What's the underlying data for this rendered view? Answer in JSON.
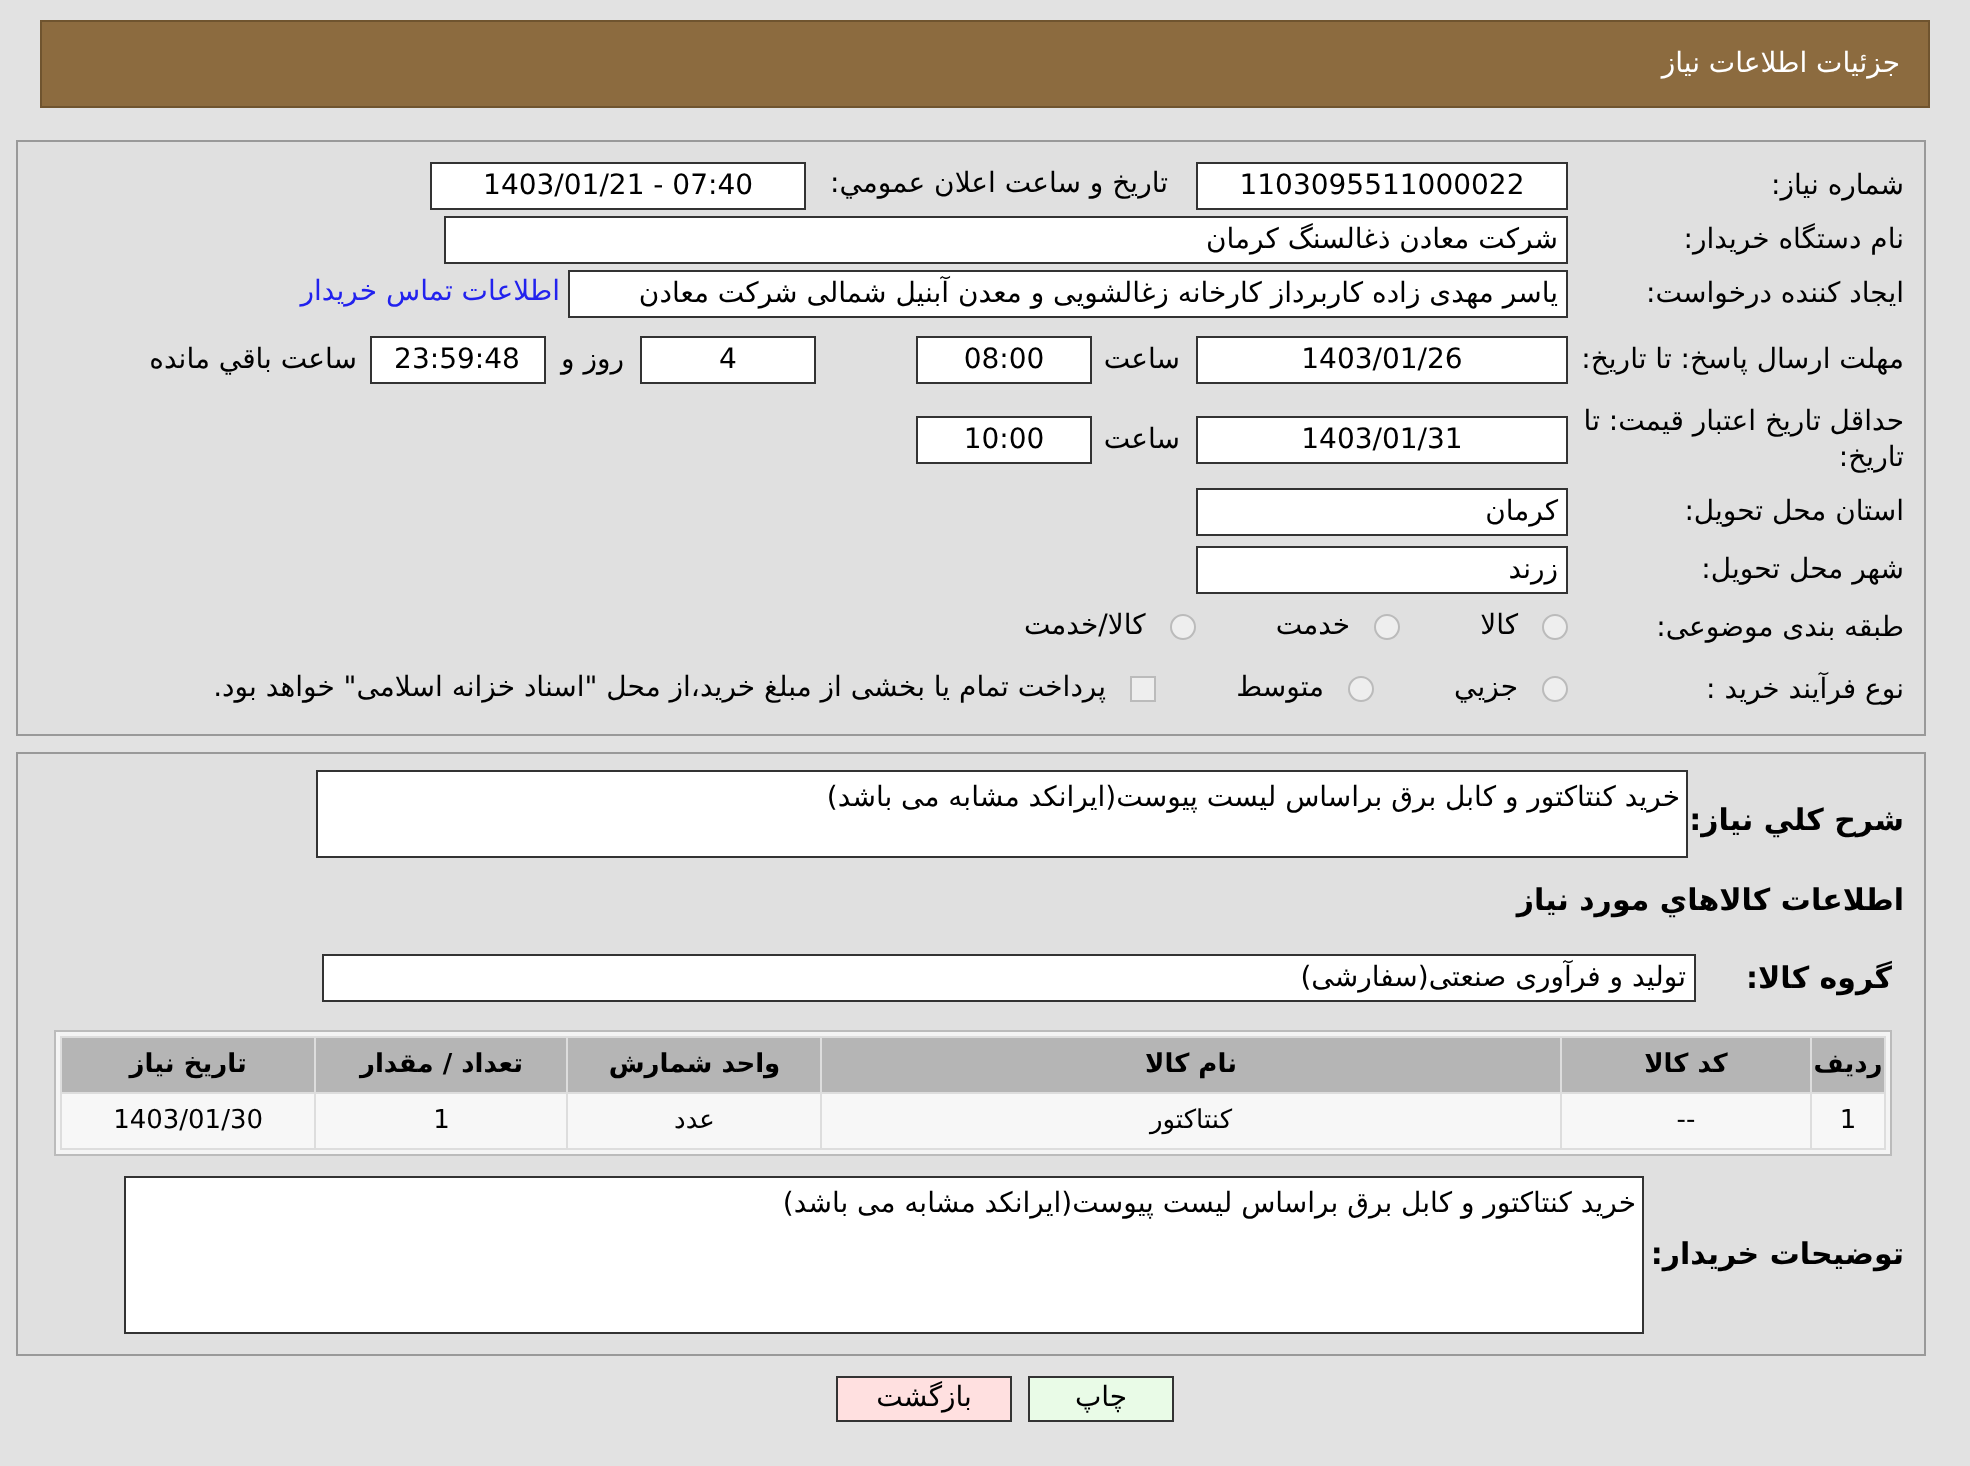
{
  "header": {
    "title": "جزئیات اطلاعات نیاز"
  },
  "details": {
    "need_number": {
      "label": "شماره نیاز:",
      "value": "1103095511000022"
    },
    "announce": {
      "label": "تاريخ و ساعت اعلان عمومي:",
      "value": "1403/01/21 - 07:40"
    },
    "buyer": {
      "label": "نام دستگاه خريدار:",
      "value": "شرکت معادن ذغالسنگ کرمان"
    },
    "creator": {
      "label": "ایجاد کننده درخواست:",
      "value": "یاسر مهدی زاده کاربرداز کارخانه زغالشویی و معدن آبنیل شمالی  شرکت معادن",
      "link": "اطلاعات تماس خريدار"
    },
    "deadline": {
      "label": "مهلت ارسال پاسخ: تا تاریخ:",
      "date": "1403/01/26",
      "time_label": "ساعت",
      "time": "08:00",
      "days": "4",
      "days_label": "روز و",
      "remaining": "23:59:48",
      "remaining_label": "ساعت باقي مانده"
    },
    "validity": {
      "label": "حداقل تاریخ اعتبار قیمت: تا تاریخ:",
      "date": "1403/01/31",
      "time_label": "ساعت",
      "time": "10:00"
    },
    "province": {
      "label": "استان محل تحویل:",
      "value": "کرمان"
    },
    "city": {
      "label": "شهر محل تحویل:",
      "value": "زرند"
    },
    "category": {
      "label": "طبقه بندی موضوعی:",
      "options": [
        {
          "label": "کالا",
          "selected": false
        },
        {
          "label": "خدمت",
          "selected": false
        },
        {
          "label": "کالا/خدمت",
          "selected": false
        }
      ]
    },
    "purchase_type": {
      "label": "نوع فرآیند خرید :",
      "options": [
        {
          "label": "جزيي",
          "selected": false
        },
        {
          "label": "متوسط",
          "selected": false
        }
      ],
      "payment": {
        "label": "پرداخت تمام یا بخشی از مبلغ خرید،از محل \"اسناد خزانه اسلامی\" خواهد بود.",
        "checked": false
      }
    }
  },
  "needs": {
    "summary": {
      "label": "شرح كلي نياز:",
      "value": "خرید کنتاکتور و کابل برق براساس لیست پیوست(ایرانکد مشابه می باشد)"
    },
    "goods_heading": "اطلاعات كالاهاي مورد نياز",
    "group": {
      "label": "گروه كالا:",
      "value": "تولید و فرآوری صنعتی(سفارشی)"
    },
    "table": {
      "columns": [
        "رديف",
        "كد كالا",
        "نام كالا",
        "واحد شمارش",
        "تعداد / مقدار",
        "تاريخ نياز"
      ],
      "rows": [
        [
          "1",
          "--",
          "کنتاکتور",
          "عدد",
          "1",
          "1403/01/30"
        ]
      ]
    },
    "buyer_notes": {
      "label": "توضيحات خريدار:",
      "value": "خرید کنتاکتور و کابل برق براساس لیست پیوست(ایرانکد مشابه می باشد)"
    }
  },
  "buttons": [
    {
      "label": "چاپ",
      "kind": "print"
    },
    {
      "label": "بازگشت",
      "kind": "back"
    }
  ]
}
